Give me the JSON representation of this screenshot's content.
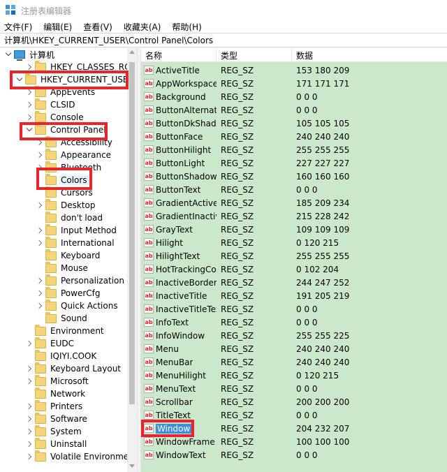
{
  "window": {
    "title": "注册表编辑器"
  },
  "menu": [
    "文件(F)",
    "编辑(E)",
    "查看(V)",
    "收藏夹(A)",
    "帮助(H)"
  ],
  "address": "计算机\\HKEY_CURRENT_USER\\Control Panel\\Colors",
  "columns": {
    "name": "名称",
    "type": "类型",
    "data": "数据"
  },
  "tree": {
    "root": "计算机",
    "hkcr": "HKEY_CLASSES_ROOT",
    "hkcu": "HKEY_CURRENT_USER",
    "appevents": "AppEvents",
    "clsid": "CLSID",
    "console": "Console",
    "control_panel": "Control Panel",
    "accessibility": "Accessibility",
    "appearance": "Appearance",
    "bluetooth": "Bluetooth",
    "colors": "Colors",
    "cursors": "Cursors",
    "desktop": "Desktop",
    "dont_load": "don't load",
    "input_method": "Input Method",
    "international": "International",
    "keyboard": "Keyboard",
    "mouse": "Mouse",
    "personalization": "Personalization",
    "powercfg": "PowerCfg",
    "quick_actions": "Quick Actions",
    "sound": "Sound",
    "environment": "Environment",
    "eudc": "EUDC",
    "iqiyi": "IQIYI.COOK",
    "keyboard_layout": "Keyboard Layout",
    "microsoft": "Microsoft",
    "network": "Network",
    "printers": "Printers",
    "software": "Software",
    "system": "System",
    "uninstall": "Uninstall",
    "volatile_environment": "Volatile Environment"
  },
  "values": [
    {
      "name": "ActiveTitle",
      "type": "REG_SZ",
      "data": "153 180 209"
    },
    {
      "name": "AppWorkspace",
      "type": "REG_SZ",
      "data": "171 171 171"
    },
    {
      "name": "Background",
      "type": "REG_SZ",
      "data": "0 0 0"
    },
    {
      "name": "ButtonAlternat...",
      "type": "REG_SZ",
      "data": "0 0 0"
    },
    {
      "name": "ButtonDkShad...",
      "type": "REG_SZ",
      "data": "105 105 105"
    },
    {
      "name": "ButtonFace",
      "type": "REG_SZ",
      "data": "240 240 240"
    },
    {
      "name": "ButtonHilight",
      "type": "REG_SZ",
      "data": "255 255 255"
    },
    {
      "name": "ButtonLight",
      "type": "REG_SZ",
      "data": "227 227 227"
    },
    {
      "name": "ButtonShadow",
      "type": "REG_SZ",
      "data": "160 160 160"
    },
    {
      "name": "ButtonText",
      "type": "REG_SZ",
      "data": "0 0 0"
    },
    {
      "name": "GradientActive...",
      "type": "REG_SZ",
      "data": "185 209 234"
    },
    {
      "name": "GradientInactiv...",
      "type": "REG_SZ",
      "data": "215 228 242"
    },
    {
      "name": "GrayText",
      "type": "REG_SZ",
      "data": "109 109 109"
    },
    {
      "name": "Hilight",
      "type": "REG_SZ",
      "data": "0 120 215"
    },
    {
      "name": "HilightText",
      "type": "REG_SZ",
      "data": "255 255 255"
    },
    {
      "name": "HotTrackingCo...",
      "type": "REG_SZ",
      "data": "0 102 204"
    },
    {
      "name": "InactiveBorder",
      "type": "REG_SZ",
      "data": "244 247 252"
    },
    {
      "name": "InactiveTitle",
      "type": "REG_SZ",
      "data": "191 205 219"
    },
    {
      "name": "InactiveTitleText",
      "type": "REG_SZ",
      "data": "0 0 0"
    },
    {
      "name": "InfoText",
      "type": "REG_SZ",
      "data": "0 0 0"
    },
    {
      "name": "InfoWindow",
      "type": "REG_SZ",
      "data": "255 255 225"
    },
    {
      "name": "Menu",
      "type": "REG_SZ",
      "data": "240 240 240"
    },
    {
      "name": "MenuBar",
      "type": "REG_SZ",
      "data": "240 240 240"
    },
    {
      "name": "MenuHilight",
      "type": "REG_SZ",
      "data": "0 120 215"
    },
    {
      "name": "MenuText",
      "type": "REG_SZ",
      "data": "0 0 0"
    },
    {
      "name": "Scrollbar",
      "type": "REG_SZ",
      "data": "200 200 200"
    },
    {
      "name": "TitleText",
      "type": "REG_SZ",
      "data": "0 0 0"
    },
    {
      "name": "Window",
      "type": "REG_SZ",
      "data": "204 232 207"
    },
    {
      "name": "WindowFrame",
      "type": "REG_SZ",
      "data": "100 100 100"
    },
    {
      "name": "WindowText",
      "type": "REG_SZ",
      "data": "0 0 0"
    }
  ],
  "icons": {
    "app": "registry-editor-icon",
    "value": "string-value-icon",
    "folder": "folder-icon",
    "computer": "computer-icon"
  },
  "colors": {
    "list_background": "#cbe8cb",
    "annotation": "#e8252b",
    "selection": "#3a8fe0"
  }
}
